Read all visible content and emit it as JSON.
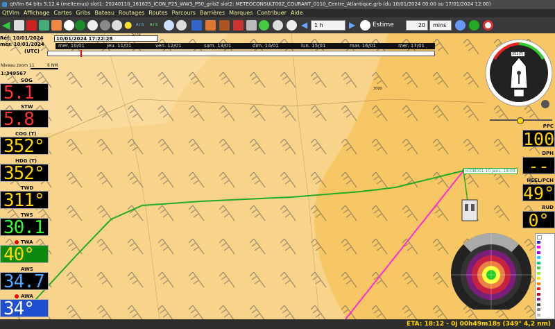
{
  "window": {
    "title": "qtVlm 64 bits 5.12.4 (meltemus) slot1: 20240110_161625_ICON_P25_WW3_P50_grib2 slot2: METEOCONSULT00Z_COURANT_0110_Centre_Atlantique.grb (du 10/01/2024 00:00 au 17/01/2024 12:00)"
  },
  "menu": [
    "QtVlm",
    "Affichage",
    "Cartes",
    "Gribs",
    "Bateau",
    "Routages",
    "Routes",
    "Parcours",
    "Barrières",
    "Marques",
    "Contribuer",
    "Aide"
  ],
  "toolbar": {
    "step_value": "1 h",
    "estime_label": "Estime",
    "estime_value": "20",
    "unit_value": "mins",
    "ais_label": "A.I.S"
  },
  "timeline": {
    "ref": "Réf: 10/01/2024",
    "current_date": "mer. 10/01/2024",
    "current_time_box": "10/01/2024 17:22:28",
    "utc": "(UTC)",
    "days": [
      "mer. 10/01",
      "jeu. 11/01",
      "ven. 12/01",
      "sam. 13/01",
      "dim. 14/01",
      "lun. 15/01",
      "mar. 16/01",
      "mer. 17/01"
    ]
  },
  "map": {
    "zoom_label": "Niveau zoom 11",
    "scale_label": "6 NM",
    "scale_ratio": "1:349567",
    "route_label": "ICON001 10 janv.-18:09",
    "contour_a": "5770",
    "contour_b": "3000"
  },
  "instruments_left": [
    {
      "label": "SOG",
      "value": "5.1",
      "color": "#ff3333",
      "bg": "#000000"
    },
    {
      "label": "STW",
      "value": "5.8",
      "color": "#ff3333",
      "bg": "#000000"
    },
    {
      "label": "COG (T)",
      "value": "352°",
      "color": "#ffd700",
      "bg": "#000000"
    },
    {
      "label": "HDG (T)",
      "value": "352°",
      "color": "#ffd700",
      "bg": "#000000"
    },
    {
      "label": "TWD",
      "value": "311°",
      "color": "#ffd700",
      "bg": "#000000"
    },
    {
      "label": "TWS",
      "value": "30.1",
      "color": "#33ff33",
      "bg": "#000000"
    },
    {
      "label": "TWA",
      "value": "40°",
      "color": "#ffd700",
      "bg": "#0d8a0d"
    },
    {
      "label": "AWS",
      "value": "34.7",
      "color": "#4da6ff",
      "bg": "#000000"
    },
    {
      "label": "AWA",
      "value": "34°",
      "color": "#ffffff",
      "bg": "#1f4fd0"
    }
  ],
  "instruments_right": [
    {
      "label": "PPC",
      "value": "100"
    },
    {
      "label": "DPH",
      "value": "----"
    },
    {
      "label": "HEEL/PCH",
      "value": "49°"
    },
    {
      "label": "RUD",
      "value": "0°"
    }
  ],
  "compass": {
    "heading": "352(T)"
  },
  "status": {
    "eta": "ETA: 18:12 - 0j 00h49m18s (349° 4,2 nm)"
  },
  "colors": {
    "sea_light": "#f8d48a",
    "sea": "#f6c764",
    "route": "#22aa22",
    "magenta": "#ff2bd6"
  }
}
